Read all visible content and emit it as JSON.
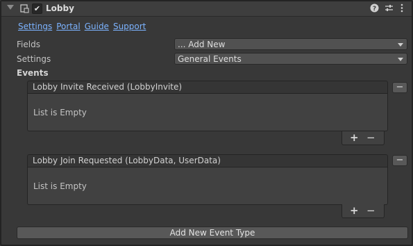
{
  "header": {
    "title": "Lobby",
    "enabled": true,
    "icons": [
      "foldout-arrow-icon",
      "script-icon",
      "help-icon",
      "preset-icon",
      "kebab-menu-icon"
    ]
  },
  "links": [
    "Settings",
    "Portal",
    "Guide",
    "Support"
  ],
  "fields": {
    "fields_label": "Fields",
    "fields_value": "... Add New",
    "settings_label": "Settings",
    "settings_value": "General Events"
  },
  "events_label": "Events",
  "events": [
    {
      "title": "Lobby Invite Received (LobbyInvite)",
      "empty_text": "List is Empty"
    },
    {
      "title": "Lobby Join Requested (LobbyData, UserData)",
      "empty_text": "List is Empty"
    }
  ],
  "buttons": {
    "plus": "+",
    "minus": "−",
    "remove": "−"
  },
  "add_event_label": "Add New Event Type",
  "colors": {
    "link": "#7cb3ff",
    "background": "#383838",
    "header": "#3e3e3e"
  }
}
